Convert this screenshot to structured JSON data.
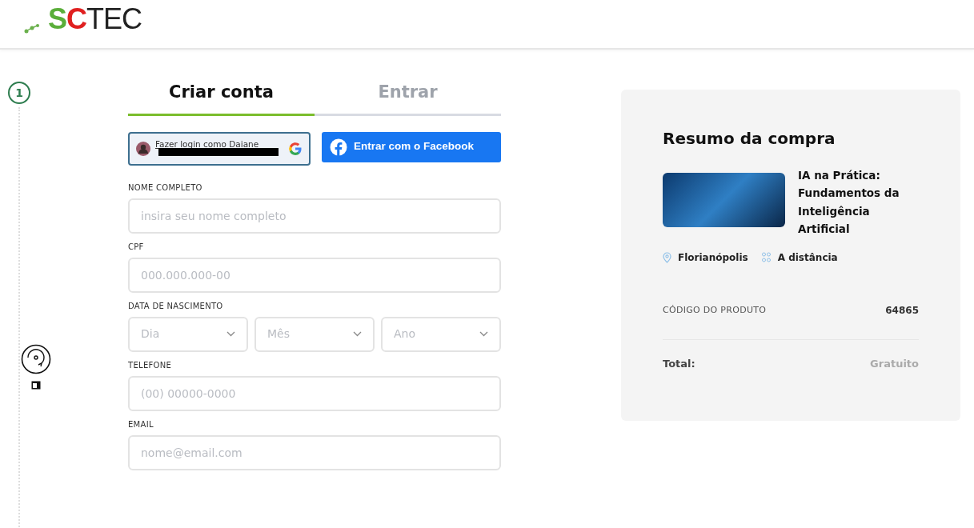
{
  "logo": [
    {
      "text": "S",
      "color": "#5aae3a"
    },
    {
      "text": "C",
      "color": "#e02020"
    },
    {
      "text": "TEC",
      "color": "#222222"
    }
  ],
  "step": {
    "number": "1"
  },
  "tabs": [
    {
      "label": "Criar conta",
      "selected": true
    },
    {
      "label": "Entrar",
      "selected": false
    }
  ],
  "google_button": {
    "label": "Fazer login como Daiane"
  },
  "facebook_button": {
    "label": "Entrar com o Facebook"
  },
  "fields": [
    {
      "kind": "text",
      "label": "NOME COMPLETO",
      "placeholder": "insira seu nome completo"
    },
    {
      "kind": "text",
      "label": "CPF",
      "placeholder": "000.000.000-00"
    },
    {
      "kind": "selects",
      "label": "DATA DE NASCIMENTO",
      "options": [
        "Dia",
        "Mês",
        "Ano"
      ]
    },
    {
      "kind": "text",
      "label": "TELEFONE",
      "placeholder": "(00) 00000-0000"
    },
    {
      "kind": "text",
      "label": "EMAIL",
      "placeholder": "nome@email.com"
    }
  ],
  "summary": {
    "title": "Resumo da compra",
    "course_title": "IA na Prática: Fundamentos da Inteligência Artificial",
    "location": "Florianópolis",
    "modality": "A distância",
    "code_label": "CÓDIGO DO PRODUTO",
    "code_value": "64865",
    "total_label": "Total:",
    "total_value": "Gratuito"
  }
}
